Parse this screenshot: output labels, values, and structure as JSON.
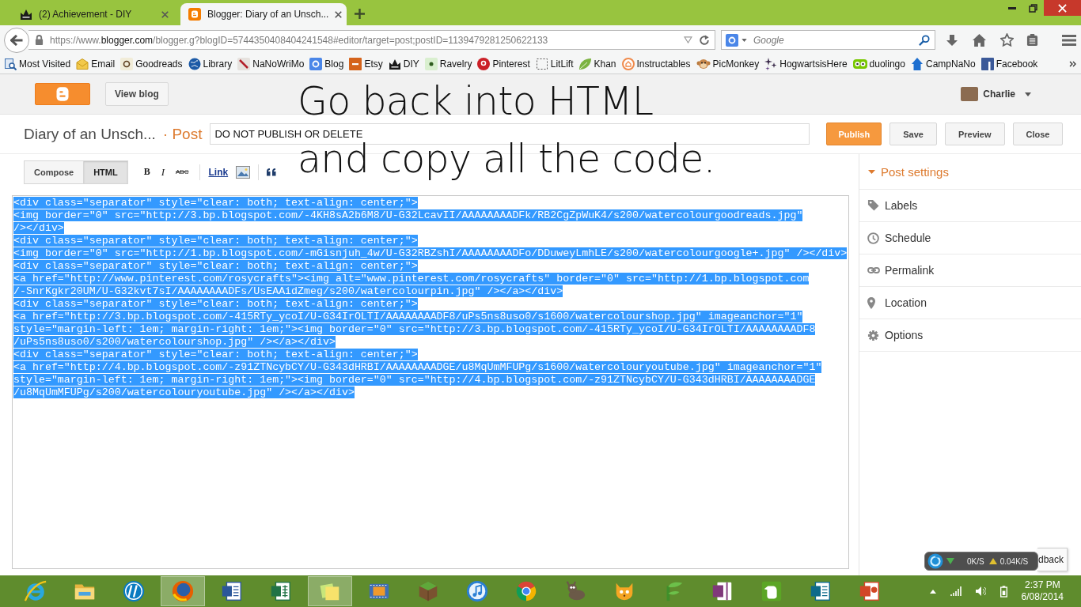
{
  "browser": {
    "tabs": [
      {
        "title": "(2) Achievement - DIY",
        "selected": false
      },
      {
        "title": "Blogger: Diary of an Unsch...",
        "selected": true
      }
    ],
    "address": "https://www.**blogger.com**/blogger.g?blogID=5744350408404241548#editor/target=post;postID=1139479281250622133",
    "search": {
      "placeholder": "Google"
    },
    "bookmarks": [
      "Most Visited",
      "Email",
      "Goodreads",
      "Library",
      "NaNoWriMo",
      "Blog",
      "Etsy",
      "DIY",
      "Ravelry",
      "Pinterest",
      "LitLift",
      "Khan",
      "Instructables",
      "PicMonkey",
      "HogwartsisHere",
      "duolingo",
      "CampNaNo",
      "Facebook"
    ]
  },
  "blogger": {
    "header": {
      "view_blog": "View blog",
      "user": "Charlie"
    },
    "post_header": {
      "blog_title": "Diary of an Unsch...",
      "section": "· Post",
      "title_field": {
        "value": "DO NOT PUBLISH OR DELETE"
      },
      "buttons": [
        {
          "label": "Publish",
          "kind": "primary"
        },
        {
          "label": "Save",
          "kind": "plain"
        },
        {
          "label": "Preview",
          "kind": "plain"
        },
        {
          "label": "Close",
          "kind": "plain"
        }
      ]
    },
    "toolbar": {
      "modes": [
        {
          "label": "Compose",
          "selected": false
        },
        {
          "label": "HTML",
          "selected": true
        }
      ],
      "format_buttons": [
        {
          "label": "B",
          "kind": "bold"
        },
        {
          "label": "I",
          "kind": "italic"
        },
        {
          "label": "ABC",
          "kind": "strike"
        },
        {
          "label": "Link",
          "kind": "link"
        }
      ]
    },
    "editor": {
      "selected": true,
      "lines": [
        "<div class=\"separator\" style=\"clear: both; text-align: center;\">",
        "<img border=\"0\" src=\"http://3.bp.blogspot.com/-4KH8sA2b6M8/U-G32LcavII/AAAAAAAADFk/RB2CgZpWuK4/s200/watercolourgoodreads.jpg\"",
        "/></div>",
        "<div class=\"separator\" style=\"clear: both; text-align: center;\">",
        "<img border=\"0\" src=\"http://1.bp.blogspot.com/-mGisnjuh_4w/U-G32RBZshI/AAAAAAAADFo/DDuweyLmhLE/s200/watercolourgoogle+.jpg\" /></div>",
        "<div class=\"separator\" style=\"clear: both; text-align: center;\">",
        "<a href=\"http://www.pinterest.com/rosycrafts\"><img alt=\"www.pinterest.com/rosycrafts\" border=\"0\" src=\"http://1.bp.blogspot.com",
        "/-SnrKgkr20UM/U-G32kvt7sI/AAAAAAAADFs/UsEAAidZmeg/s200/watercolourpin.jpg\" /></a></div>",
        "<div class=\"separator\" style=\"clear: both; text-align: center;\">",
        "<a href=\"http://3.bp.blogspot.com/-415RTy_ycoI/U-G34IrOLTI/AAAAAAAADF8/uPs5ns8uso0/s1600/watercolourshop.jpg\" imageanchor=\"1\"",
        "style=\"margin-left: 1em; margin-right: 1em;\"><img border=\"0\" src=\"http://3.bp.blogspot.com/-415RTy_ycoI/U-G34IrOLTI/AAAAAAAADF8",
        "/uPs5ns8uso0/s200/watercolourshop.jpg\" /></a></div>",
        "<div class=\"separator\" style=\"clear: both; text-align: center;\">",
        "<a href=\"http://4.bp.blogspot.com/-z91ZTNcybCY/U-G343dHRBI/AAAAAAAADGE/u8MqUmMFUPg/s1600/watercolouryoutube.jpg\" imageanchor=\"1\"",
        "style=\"margin-left: 1em; margin-right: 1em;\"><img border=\"0\" src=\"http://4.bp.blogspot.com/-z91ZTNcybCY/U-G343dHRBI/AAAAAAAADGE",
        "/u8MqUmMFUPg/s200/watercolouryoutube.jpg\" /></a></div>"
      ]
    },
    "post_settings": {
      "title": "Post settings",
      "expanded": true,
      "items": [
        "Labels",
        "Schedule",
        "Permalink",
        "Location",
        "Options"
      ]
    },
    "feedback": {
      "label": "dback"
    }
  },
  "caption": [
    "Go back into HTML",
    "and copy all the code."
  ],
  "speed_widget": {
    "download": "0K/S",
    "upload": "0.04K/S"
  },
  "taskbar": {
    "apps": [
      {
        "selected": false
      },
      {
        "selected": false
      },
      {
        "selected": false
      },
      {
        "selected": true
      },
      {
        "selected": false
      },
      {
        "selected": false
      },
      {
        "selected": true
      },
      {
        "selected": false
      },
      {
        "selected": false
      },
      {
        "selected": false
      },
      {
        "selected": false
      },
      {
        "selected": false
      },
      {
        "selected": false
      },
      {
        "selected": false
      },
      {
        "selected": false
      },
      {
        "selected": false
      },
      {
        "selected": false
      },
      {
        "selected": false
      }
    ],
    "time": "2:37 PM",
    "date": "6/08/2014"
  }
}
